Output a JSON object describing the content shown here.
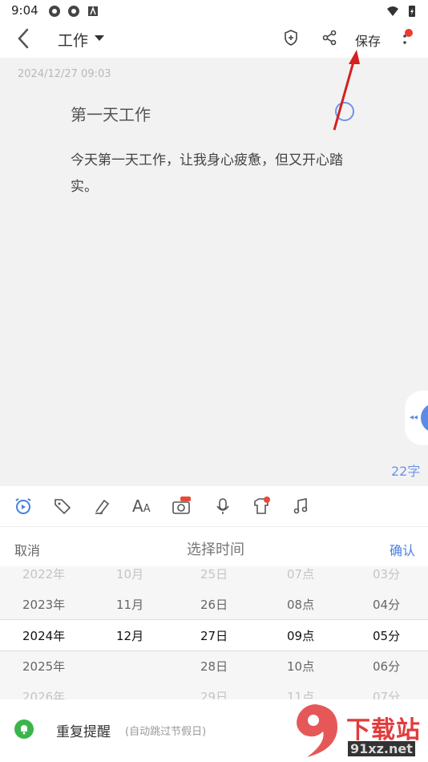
{
  "status": {
    "time": "9:04"
  },
  "header": {
    "title": "工作",
    "save_label": "保存"
  },
  "note": {
    "date": "2024/12/27 09:03",
    "title": "第一天工作",
    "body": "今天第一天工作，让我身心疲惫，但又开心踏实。",
    "char_count": "22字"
  },
  "picker": {
    "cancel": "取消",
    "title": "选择时间",
    "confirm": "确认",
    "rows": [
      [
        "2022年",
        "10月",
        "25日",
        "07点",
        "03分"
      ],
      [
        "2023年",
        "11月",
        "26日",
        "08点",
        "04分"
      ],
      [
        "2024年",
        "12月",
        "27日",
        "09点",
        "05分"
      ],
      [
        "2025年",
        "",
        "28日",
        "10点",
        "06分"
      ],
      [
        "2026年",
        "",
        "29日",
        "11点",
        "07分"
      ]
    ]
  },
  "repeat": {
    "label": "重复提醒",
    "hint": "(自动跳过节假日)"
  },
  "watermark": {
    "title": "下载站",
    "url": "91xz.net"
  },
  "colors": {
    "accent": "#4a7fe0",
    "red": "#ea3b2f",
    "green": "#3bb54a"
  }
}
